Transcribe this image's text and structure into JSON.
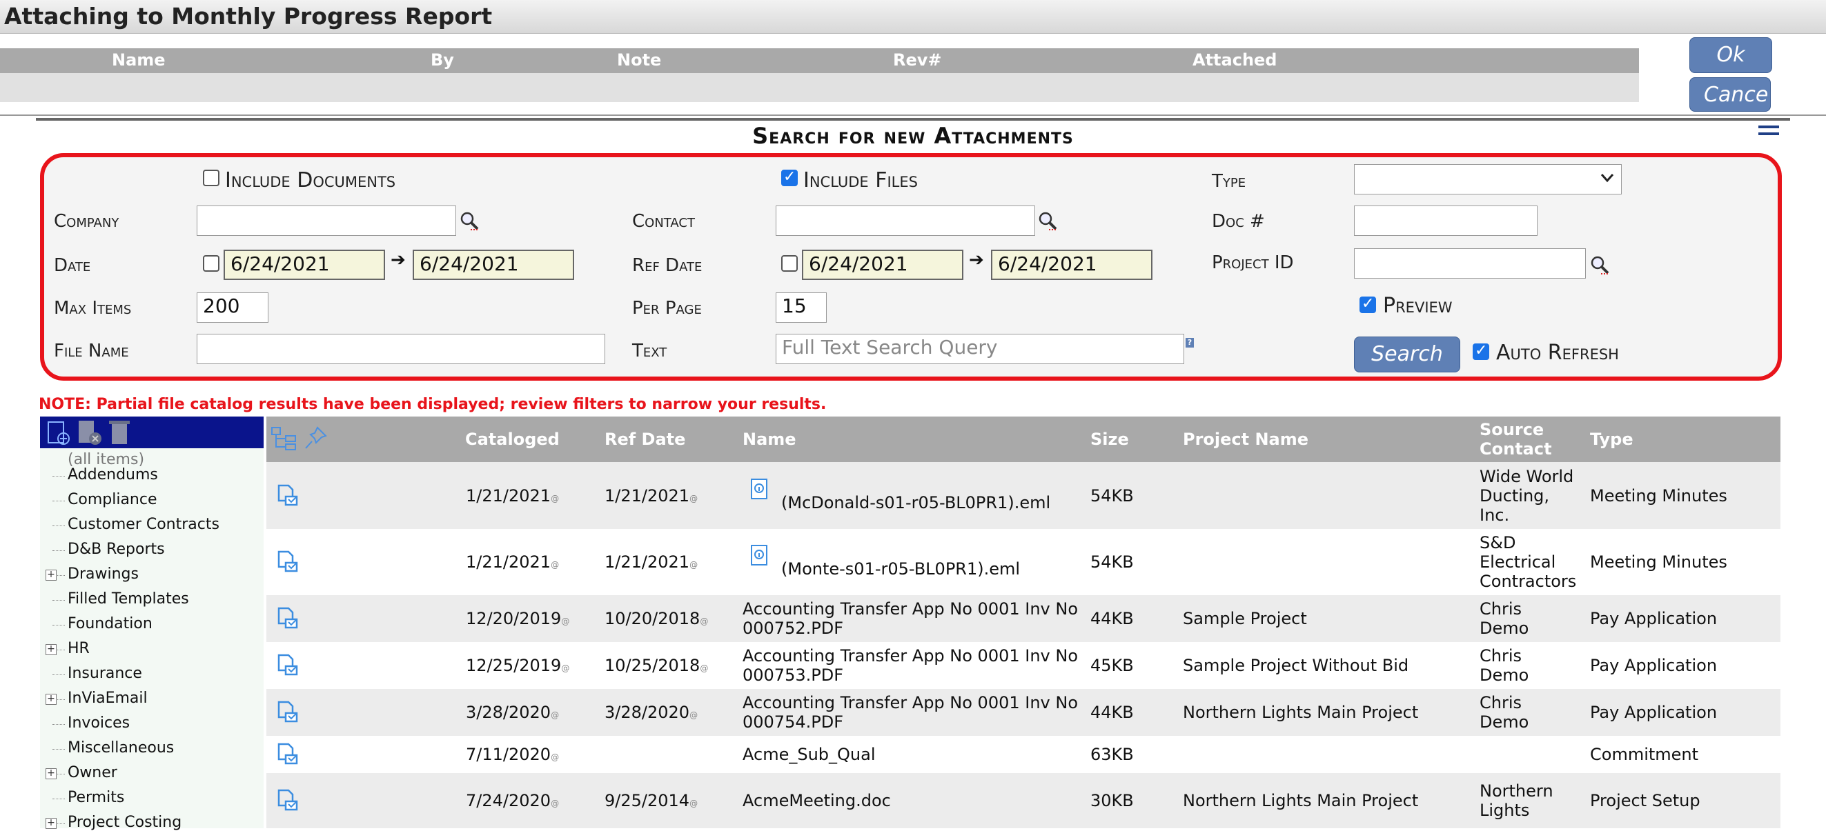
{
  "window": {
    "title": "Attaching to Monthly Progress Report"
  },
  "attached": {
    "columns": [
      "Name",
      "By",
      "Note",
      "Rev#",
      "Attached"
    ]
  },
  "buttons": {
    "ok": "Ok",
    "cancel": "Cance"
  },
  "search": {
    "title": "Search for new Attachments",
    "include_documents": {
      "label": "Include Documents",
      "checked": false
    },
    "include_files": {
      "label": "Include Files",
      "checked": true
    },
    "type_label": "Type",
    "type_value": "",
    "company_label": "Company",
    "company_value": "",
    "contact_label": "Contact",
    "contact_value": "",
    "doc_label": "Doc #",
    "doc_value": "",
    "date_label": "Date",
    "date_from": "6/24/2021",
    "date_to": "6/24/2021",
    "ref_date_label": "Ref Date",
    "ref_date_from": "6/24/2021",
    "ref_date_to": "6/24/2021",
    "project_id_label": "Project ID",
    "project_id_value": "",
    "max_items_label": "Max Items",
    "max_items_value": "200",
    "per_page_label": "Per Page",
    "per_page_value": "15",
    "preview": {
      "label": "Preview",
      "checked": true
    },
    "file_name_label": "File Name",
    "file_name_value": "",
    "text_label": "Text",
    "text_placeholder": "Full Text Search Query",
    "help": "?",
    "search_button": "Search",
    "auto_refresh": {
      "label": "Auto Refresh",
      "checked": true
    }
  },
  "note": "NOTE: Partial file catalog results have been displayed; review filters to narrow your results.",
  "tree": {
    "all_items": "(all items)",
    "items": [
      {
        "label": "Addendums",
        "expandable": false
      },
      {
        "label": "Compliance",
        "expandable": false
      },
      {
        "label": "Customer Contracts",
        "expandable": false
      },
      {
        "label": "D&B Reports",
        "expandable": false
      },
      {
        "label": "Drawings",
        "expandable": true
      },
      {
        "label": "Filled Templates",
        "expandable": false
      },
      {
        "label": "Foundation",
        "expandable": false
      },
      {
        "label": "HR",
        "expandable": true
      },
      {
        "label": "Insurance",
        "expandable": false
      },
      {
        "label": "InViaEmail",
        "expandable": true
      },
      {
        "label": "Invoices",
        "expandable": false
      },
      {
        "label": "Miscellaneous",
        "expandable": false
      },
      {
        "label": "Owner",
        "expandable": true
      },
      {
        "label": "Permits",
        "expandable": false
      },
      {
        "label": "Project Costing",
        "expandable": true
      }
    ]
  },
  "grid": {
    "columns": {
      "cataloged": "Cataloged",
      "ref_date": "Ref Date",
      "name": "Name",
      "size": "Size",
      "project": "Project Name",
      "source1": "Source",
      "source2": "Contact",
      "type": "Type"
    },
    "marker": "@",
    "rows": [
      {
        "cataloged": "1/21/2021",
        "ref_date": "1/21/2021",
        "name1": "(McDonald-s01-r05-BL0PR1).eml",
        "name2": "",
        "size": "54KB",
        "project": "",
        "source": [
          "Wide World",
          "Ducting,",
          "Inc."
        ],
        "type": "Meeting Minutes",
        "email": true
      },
      {
        "cataloged": "1/21/2021",
        "ref_date": "1/21/2021",
        "name1": "(Monte-s01-r05-BL0PR1).eml",
        "name2": "",
        "size": "54KB",
        "project": "",
        "source": [
          "S&D",
          "Electrical",
          "Contractors"
        ],
        "type": "Meeting Minutes",
        "email": true
      },
      {
        "cataloged": "12/20/2019",
        "ref_date": "10/20/2018",
        "name1": "Accounting Transfer App No 0001 Inv No",
        "name2": "000752.PDF",
        "size": "44KB",
        "project": "Sample Project",
        "source": [
          "Chris",
          "Demo"
        ],
        "type": "Pay Application",
        "email": false
      },
      {
        "cataloged": "12/25/2019",
        "ref_date": "10/25/2018",
        "name1": "Accounting Transfer App No 0001 Inv No",
        "name2": "000753.PDF",
        "size": "45KB",
        "project": "Sample Project Without Bid",
        "source": [
          "Chris",
          "Demo"
        ],
        "type": "Pay Application",
        "email": false
      },
      {
        "cataloged": "3/28/2020",
        "ref_date": "3/28/2020",
        "name1": "Accounting Transfer App No 0001 Inv No",
        "name2": "000754.PDF",
        "size": "44KB",
        "project": "Northern Lights Main Project",
        "source": [
          "Chris",
          "Demo"
        ],
        "type": "Pay Application",
        "email": false
      },
      {
        "cataloged": "7/11/2020",
        "ref_date": "",
        "name1": "Acme_Sub_Qual",
        "name2": "",
        "size": "63KB",
        "project": "",
        "source": [],
        "type": "Commitment",
        "email": false
      },
      {
        "cataloged": "7/24/2020",
        "ref_date": "9/25/2014",
        "name1": "AcmeMeeting.doc",
        "name2": "",
        "size": "30KB",
        "project": "Northern Lights Main Project",
        "source": [
          "Northern",
          "Lights"
        ],
        "type": "Project Setup",
        "email": false
      }
    ]
  }
}
